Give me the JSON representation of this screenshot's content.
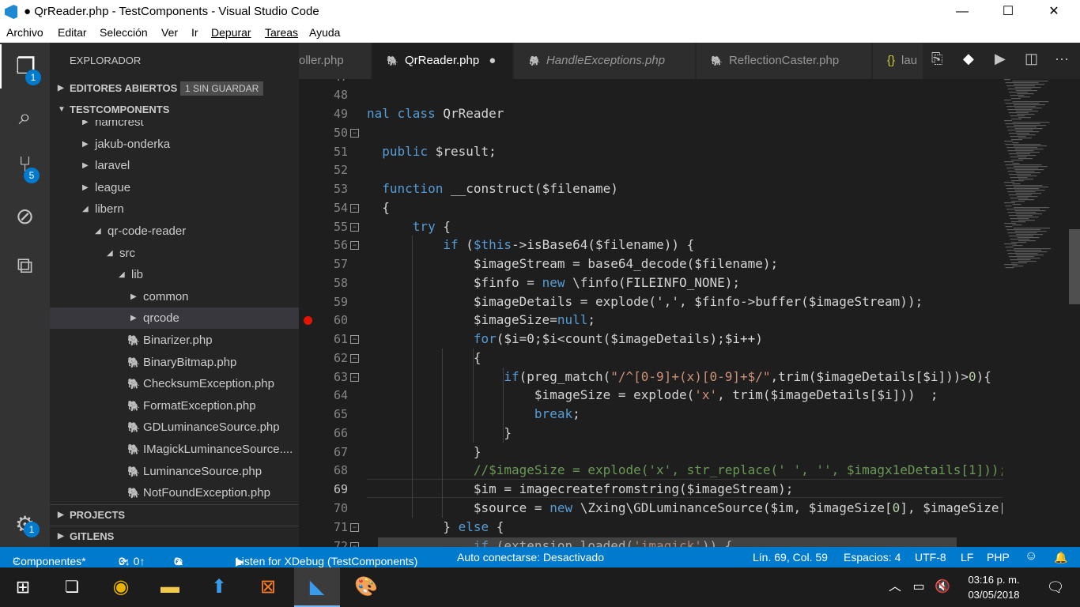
{
  "window": {
    "title": "● QrReader.php - TestComponents - Visual Studio Code",
    "minimize": "—",
    "maximize": "☐",
    "close": "✕"
  },
  "menu": [
    "Archivo",
    "Editar",
    "Selección",
    "Ver",
    "Ir",
    "Depurar",
    "Tareas",
    "Ayuda"
  ],
  "activity": {
    "explorer_badge": "1",
    "scm_badge": "5",
    "settings_badge": "1"
  },
  "sidebar": {
    "title": "EXPLORADOR",
    "open_editors": "EDITORES ABIERTOS",
    "unsaved_badge": "1 SIN GUARDAR",
    "project": "TESTCOMPONENTS",
    "tree": [
      {
        "label": "hamcrest",
        "type": "folder",
        "open": false,
        "depth": 0
      },
      {
        "label": "jakub-onderka",
        "type": "folder",
        "open": false,
        "depth": 0
      },
      {
        "label": "laravel",
        "type": "folder",
        "open": false,
        "depth": 0
      },
      {
        "label": "league",
        "type": "folder",
        "open": false,
        "depth": 0
      },
      {
        "label": "libern",
        "type": "folder",
        "open": true,
        "depth": 0
      },
      {
        "label": "qr-code-reader",
        "type": "folder",
        "open": true,
        "depth": 1
      },
      {
        "label": "src",
        "type": "folder",
        "open": true,
        "depth": 2
      },
      {
        "label": "lib",
        "type": "folder",
        "open": true,
        "depth": 3
      },
      {
        "label": "common",
        "type": "folder",
        "open": false,
        "depth": 4
      },
      {
        "label": "qrcode",
        "type": "folder",
        "open": false,
        "depth": 4,
        "selected": true
      },
      {
        "label": "Binarizer.php",
        "type": "php",
        "depth": 4
      },
      {
        "label": "BinaryBitmap.php",
        "type": "php",
        "depth": 4
      },
      {
        "label": "ChecksumException.php",
        "type": "php",
        "depth": 4
      },
      {
        "label": "FormatException.php",
        "type": "php",
        "depth": 4
      },
      {
        "label": "GDLuminanceSource.php",
        "type": "php",
        "depth": 4
      },
      {
        "label": "IMagickLuminanceSource....",
        "type": "php",
        "depth": 4
      },
      {
        "label": "LuminanceSource.php",
        "type": "php",
        "depth": 4
      },
      {
        "label": "NotFoundException.php",
        "type": "php",
        "depth": 4
      }
    ],
    "projects": "PROJECTS",
    "gitlens": "GITLENS"
  },
  "tabs": [
    {
      "label": "oller.php",
      "icon": "php"
    },
    {
      "label": "QrReader.php",
      "icon": "php",
      "active": true,
      "dirty": true
    },
    {
      "label": "HandleExceptions.php",
      "icon": "php",
      "italic": true
    },
    {
      "label": "ReflectionCaster.php",
      "icon": "php"
    },
    {
      "label": "lau",
      "icon": "json"
    }
  ],
  "editor": {
    "current_line": 69,
    "breakpoint_line": 60,
    "lines": [
      {
        "n": 47,
        "t": []
      },
      {
        "n": 48,
        "t": []
      },
      {
        "n": 49,
        "t": [
          [
            "nal ",
            "kw"
          ],
          [
            "class ",
            "kw"
          ],
          [
            "QrReader",
            ""
          ]
        ]
      },
      {
        "n": 50,
        "fold": true,
        "t": []
      },
      {
        "n": 51,
        "t": [
          [
            "  ",
            ""
          ],
          [
            "public ",
            "kw"
          ],
          [
            "$result;",
            ""
          ]
        ]
      },
      {
        "n": 52,
        "t": []
      },
      {
        "n": 53,
        "t": [
          [
            "  ",
            ""
          ],
          [
            "function ",
            "kw"
          ],
          [
            "__construct($filename)",
            ""
          ]
        ]
      },
      {
        "n": 54,
        "fold": true,
        "t": [
          [
            "  {",
            ""
          ]
        ]
      },
      {
        "n": 55,
        "fold": true,
        "t": [
          [
            "      ",
            ""
          ],
          [
            "try ",
            "kw"
          ],
          [
            "{",
            ""
          ]
        ]
      },
      {
        "n": 56,
        "fold": true,
        "t": [
          [
            "          ",
            ""
          ],
          [
            "if ",
            "kw"
          ],
          [
            "(",
            ""
          ],
          [
            "$this",
            "kw"
          ],
          [
            "->isBase64($filename)) {",
            ""
          ]
        ]
      },
      {
        "n": 57,
        "t": [
          [
            "              $imageStream = base64_decode($filename);",
            ""
          ]
        ]
      },
      {
        "n": 58,
        "t": [
          [
            "              $finfo = ",
            ""
          ],
          [
            "new ",
            "kw"
          ],
          [
            "\\finfo(FILEINFO_NONE);",
            ""
          ]
        ]
      },
      {
        "n": 59,
        "t": [
          [
            "              $imageDetails = explode(",
            ""
          ],
          [
            "','",
            ""
          ],
          [
            ", $finfo->buffer($imageStream));",
            ""
          ]
        ]
      },
      {
        "n": 60,
        "t": [
          [
            "              $imageSize=",
            ""
          ],
          [
            "null",
            "kw"
          ],
          [
            ";",
            ""
          ]
        ]
      },
      {
        "n": 61,
        "fold": true,
        "t": [
          [
            "              ",
            ""
          ],
          [
            "for",
            "kw"
          ],
          [
            "($i=0;$i<count($imageDetails);$i++)",
            ""
          ]
        ]
      },
      {
        "n": 62,
        "fold": true,
        "t": [
          [
            "              {",
            ""
          ]
        ]
      },
      {
        "n": 63,
        "fold": true,
        "t": [
          [
            "                  ",
            ""
          ],
          [
            "if",
            "kw"
          ],
          [
            "(preg_match(",
            ""
          ],
          [
            "\"/^[0-9]+(x)[0-9]+$/\"",
            "str"
          ],
          [
            ",trim($imageDetails[$i]))>",
            ""
          ],
          [
            "0",
            "num"
          ],
          [
            "){",
            ""
          ]
        ]
      },
      {
        "n": 64,
        "t": [
          [
            "                      $imageSize = explode(",
            ""
          ],
          [
            "'x'",
            "str"
          ],
          [
            ", trim($imageDetails[$i]))  ;",
            ""
          ]
        ]
      },
      {
        "n": 65,
        "t": [
          [
            "                      ",
            ""
          ],
          [
            "break",
            "kw"
          ],
          [
            ";",
            ""
          ]
        ]
      },
      {
        "n": 66,
        "t": [
          [
            "                  }",
            ""
          ]
        ]
      },
      {
        "n": 67,
        "t": [
          [
            "              }",
            ""
          ]
        ]
      },
      {
        "n": 68,
        "t": [
          [
            "              ",
            ""
          ],
          [
            "//$imageSize = explode('x', str_replace(' ', '', $imagx1eDetails[1]));",
            "cm"
          ]
        ]
      },
      {
        "n": 69,
        "t": [
          [
            "              $im = imagecreatefromstring($imageStream);",
            ""
          ]
        ]
      },
      {
        "n": 70,
        "t": [
          [
            "              $source = ",
            ""
          ],
          [
            "new ",
            "kw"
          ],
          [
            "\\Zxing\\GDLuminanceSource($im, $imageSize[",
            ""
          ],
          [
            "0",
            "num"
          ],
          [
            "], $imageSize[",
            ""
          ]
        ]
      },
      {
        "n": 71,
        "fold": true,
        "t": [
          [
            "          } ",
            ""
          ],
          [
            "else ",
            "kw"
          ],
          [
            "{",
            ""
          ]
        ]
      },
      {
        "n": 72,
        "fold": true,
        "t": [
          [
            "              ",
            ""
          ],
          [
            "if ",
            "kw"
          ],
          [
            "(extension_loaded(",
            ""
          ],
          [
            "'imagick'",
            "str"
          ],
          [
            ")) {",
            ""
          ]
        ]
      }
    ]
  },
  "statusbar": {
    "branch": "Componentes*",
    "sync": "3↓ 0↑",
    "errors": "0",
    "warnings": "0",
    "debug": "Listen for XDebug (TestComponents)",
    "auto": "Auto conectarse: Desactivado",
    "position": "Lín. 69, Col. 59",
    "spaces": "Espacios: 4",
    "encoding": "UTF-8",
    "eol": "LF",
    "language": "PHP"
  },
  "taskbar": {
    "time": "03:16 p. m.",
    "date": "03/05/2018"
  },
  "colors": {
    "accent": "#007acc",
    "keyword": "#569cd6",
    "string": "#ce9178",
    "comment": "#6a9955",
    "php_icon": "#b08ee6"
  }
}
